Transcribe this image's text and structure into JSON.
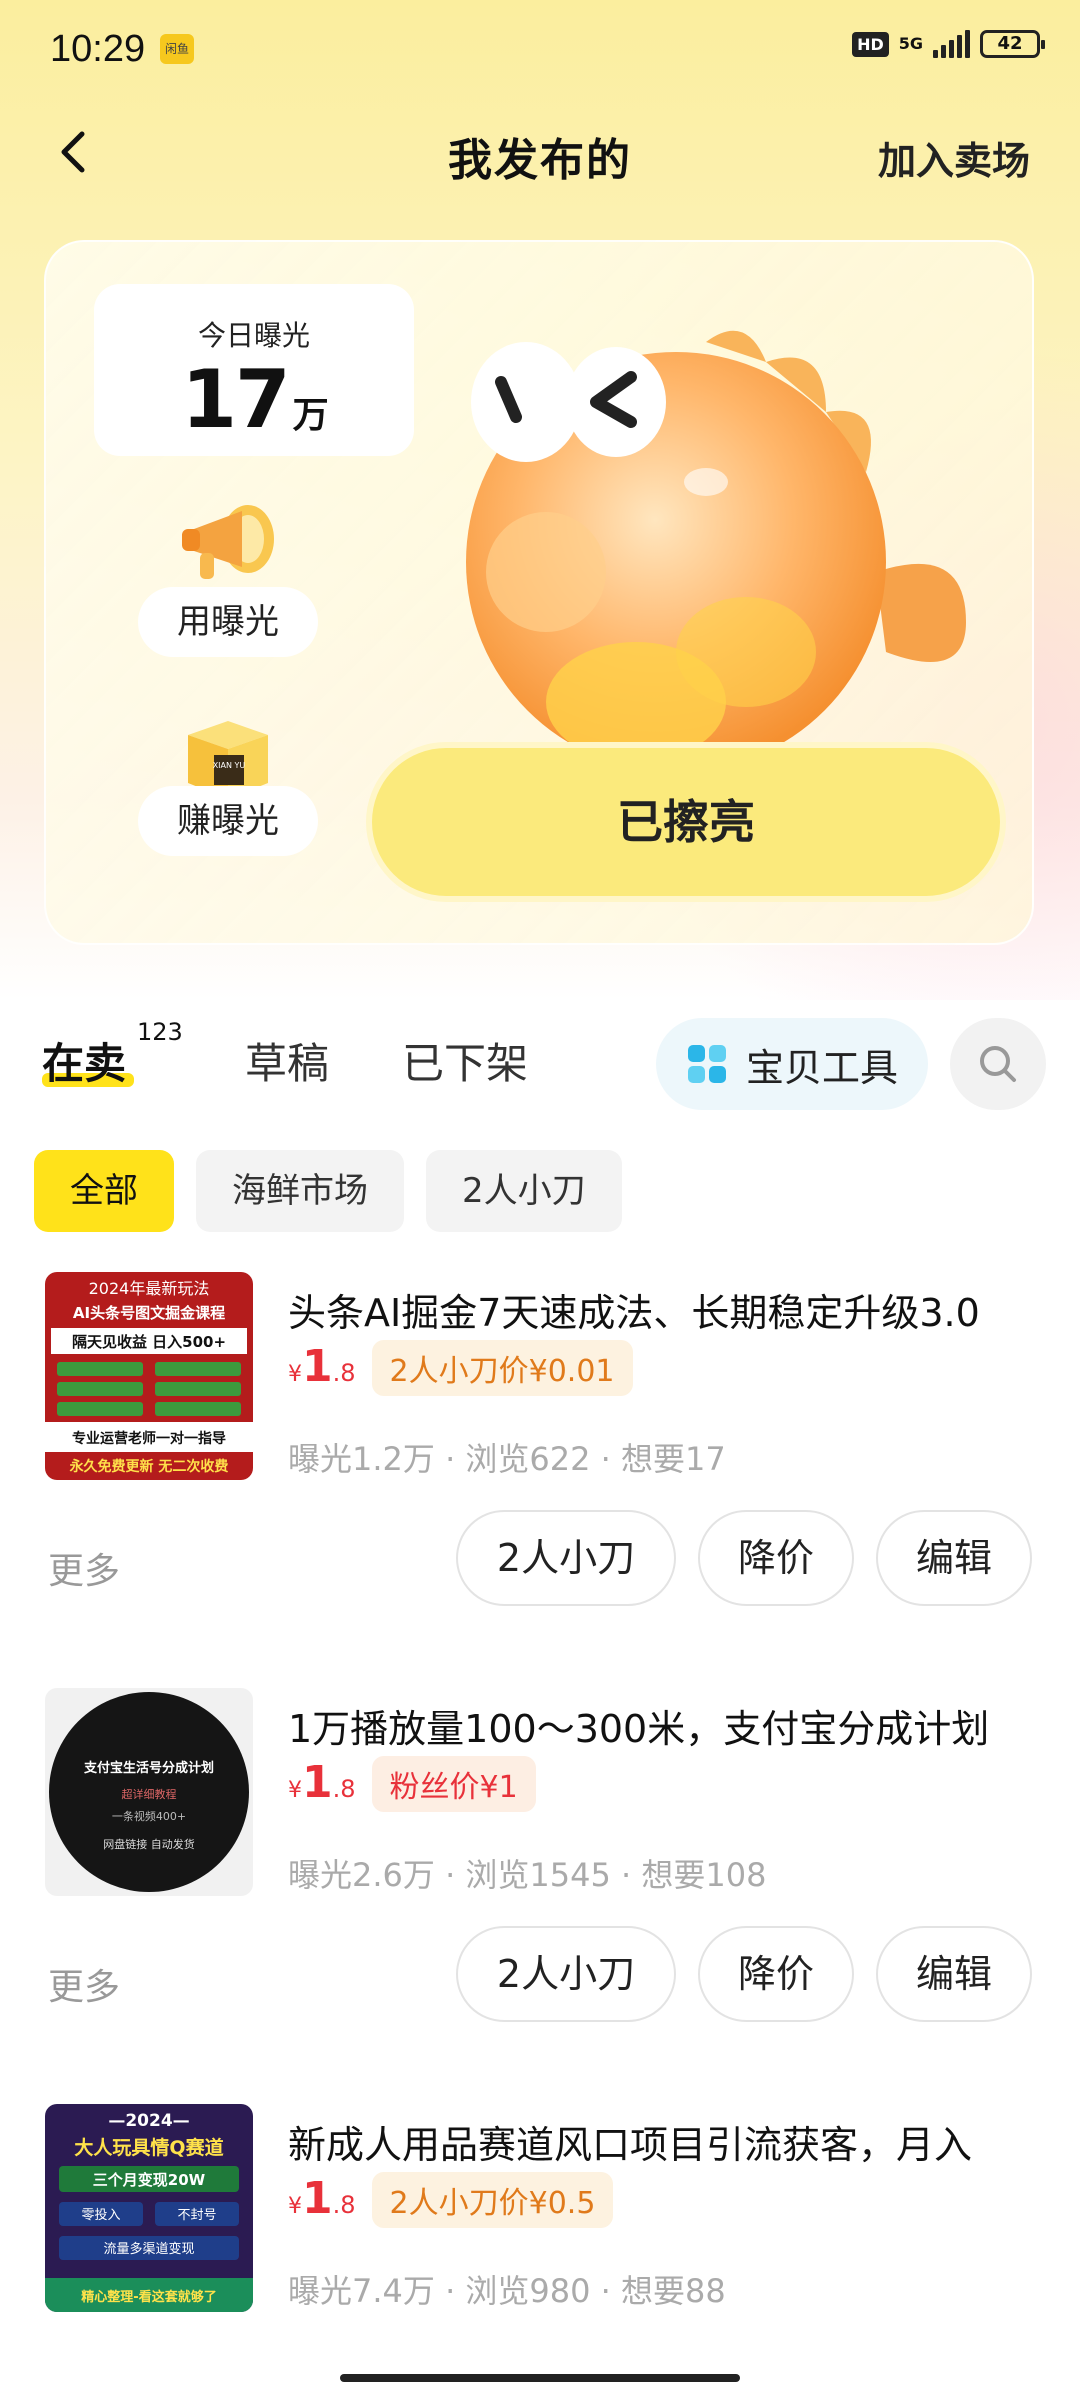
{
  "status_bar": {
    "time": "10:29",
    "badge": "闲鱼",
    "hd": "HD",
    "network": "5G",
    "battery": "42"
  },
  "nav": {
    "title": "我发布的",
    "join_market": "加入卖场"
  },
  "hero": {
    "exposure_label": "今日曝光",
    "exposure_value": "17",
    "exposure_unit": "万",
    "use_exposure": "用曝光",
    "earn_exposure": "赚曝光",
    "box_label": "XIAN YU",
    "polished_label": "已擦亮"
  },
  "tabs": {
    "on_sale": "在卖",
    "on_sale_count": "123",
    "drafts": "草稿",
    "off_shelf": "已下架",
    "tools": "宝贝工具"
  },
  "filters": [
    "全部",
    "海鲜市场",
    "2人小刀"
  ],
  "items": [
    {
      "title": "头条AI掘金7天速成法、长期稳定升级3.0",
      "price_symbol": "¥",
      "price_int": "1",
      "price_dec": ".8",
      "promo": "2人小刀价¥0.01",
      "stats": "曝光1.2万 · 浏览622 · 想要17",
      "thumb": {
        "line1": "2024年最新玩法",
        "line2": "AI头条号图文掘金课程",
        "line3": "隔天见收益 日入500+",
        "line4": "专业运营老师一对一指导",
        "line5": "永久免费更新 无二次收费"
      }
    },
    {
      "title": "1万播放量100～300米，支付宝分成计划",
      "price_symbol": "¥",
      "price_int": "1",
      "price_dec": ".8",
      "promo": "粉丝价¥1",
      "stats": "曝光2.6万 · 浏览1545 · 想要108",
      "thumb": {
        "line1": "支付宝生活号分成计划",
        "line2": "超详细教程",
        "line3": "一条视频400+",
        "line4": "网盘链接 自动发货"
      }
    },
    {
      "title": "新成人用品赛道风口项目引流获客，月入",
      "price_symbol": "¥",
      "price_int": "1",
      "price_dec": ".8",
      "promo": "2人小刀价¥0.5",
      "stats": "曝光7.4万 · 浏览980 · 想要88",
      "thumb": {
        "line1": "—2024—",
        "line2": "大人玩具情Q赛道",
        "line3": "三个月变现20W",
        "line4": "零投入",
        "line5": "不封号",
        "line6": "流量多渠道变现",
        "line7": "精心整理-看这套就够了"
      }
    }
  ],
  "item_actions": {
    "more": "更多",
    "bargain": "2人小刀",
    "reduce_price": "降价",
    "edit": "编辑"
  }
}
